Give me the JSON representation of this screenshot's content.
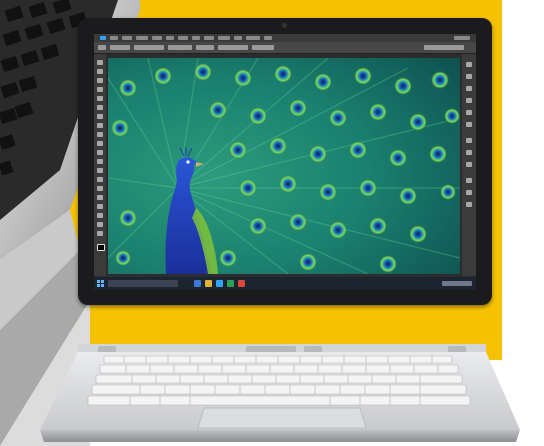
{
  "scene": {
    "subject": "",
    "colors": {
      "background_accent": "#f6c200",
      "device_frame": "#1b1b1d",
      "keyboard_silver": "#d9dadc",
      "screen_teal": "#1e8c7c",
      "peacock_blue": "#1f3fb8",
      "taskbar": "#1c2430"
    },
    "icons": [
      "windows-start-icon",
      "photoshop-tool-icon",
      "taskbar-app-icon"
    ]
  }
}
